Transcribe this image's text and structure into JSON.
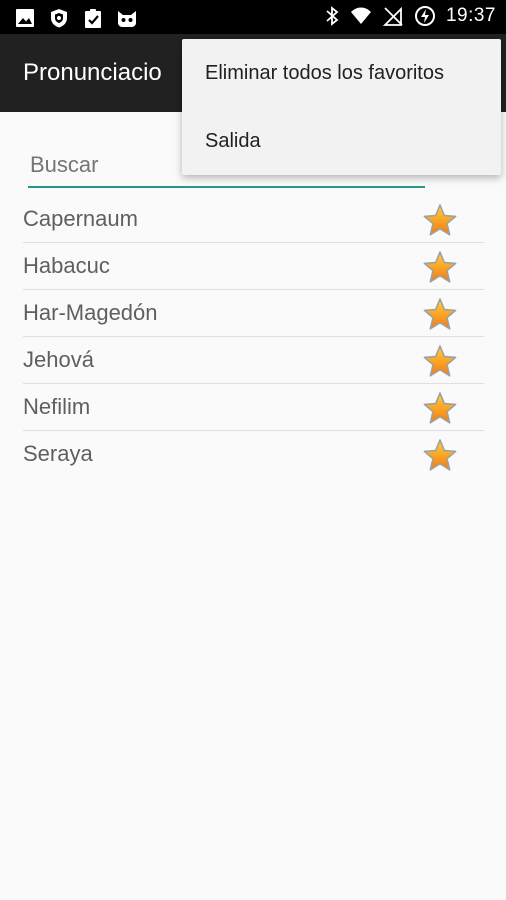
{
  "status_bar": {
    "time": "19:37",
    "icons_left": [
      "image-icon",
      "shield-icon",
      "clipboard-check-icon",
      "cat-icon"
    ],
    "icons_right": [
      "bluetooth-icon",
      "wifi-icon",
      "no-signal-icon",
      "battery-charging-icon"
    ]
  },
  "app_bar": {
    "title": "Pronunciacio"
  },
  "search": {
    "placeholder": "Buscar"
  },
  "favorites": {
    "items": [
      {
        "label": "Capernaum",
        "icon": "star-icon"
      },
      {
        "label": "Habacuc",
        "icon": "star-icon"
      },
      {
        "label": "Har-Magedón",
        "icon": "star-icon"
      },
      {
        "label": "Jehová",
        "icon": "star-icon"
      },
      {
        "label": "Nefilim",
        "icon": "star-icon"
      },
      {
        "label": "Seraya",
        "icon": "star-icon"
      }
    ]
  },
  "overflow_menu": {
    "items": [
      {
        "label": "Eliminar todos los favoritos"
      },
      {
        "label": "Salida"
      }
    ]
  },
  "colors": {
    "status_bar": "#000000",
    "app_bar": "#212121",
    "accent": "#26968a",
    "background": "#fafafa",
    "menu_background": "#f2f2f2",
    "star_fill": "#fbb017",
    "star_border": "#9e9e9e"
  }
}
